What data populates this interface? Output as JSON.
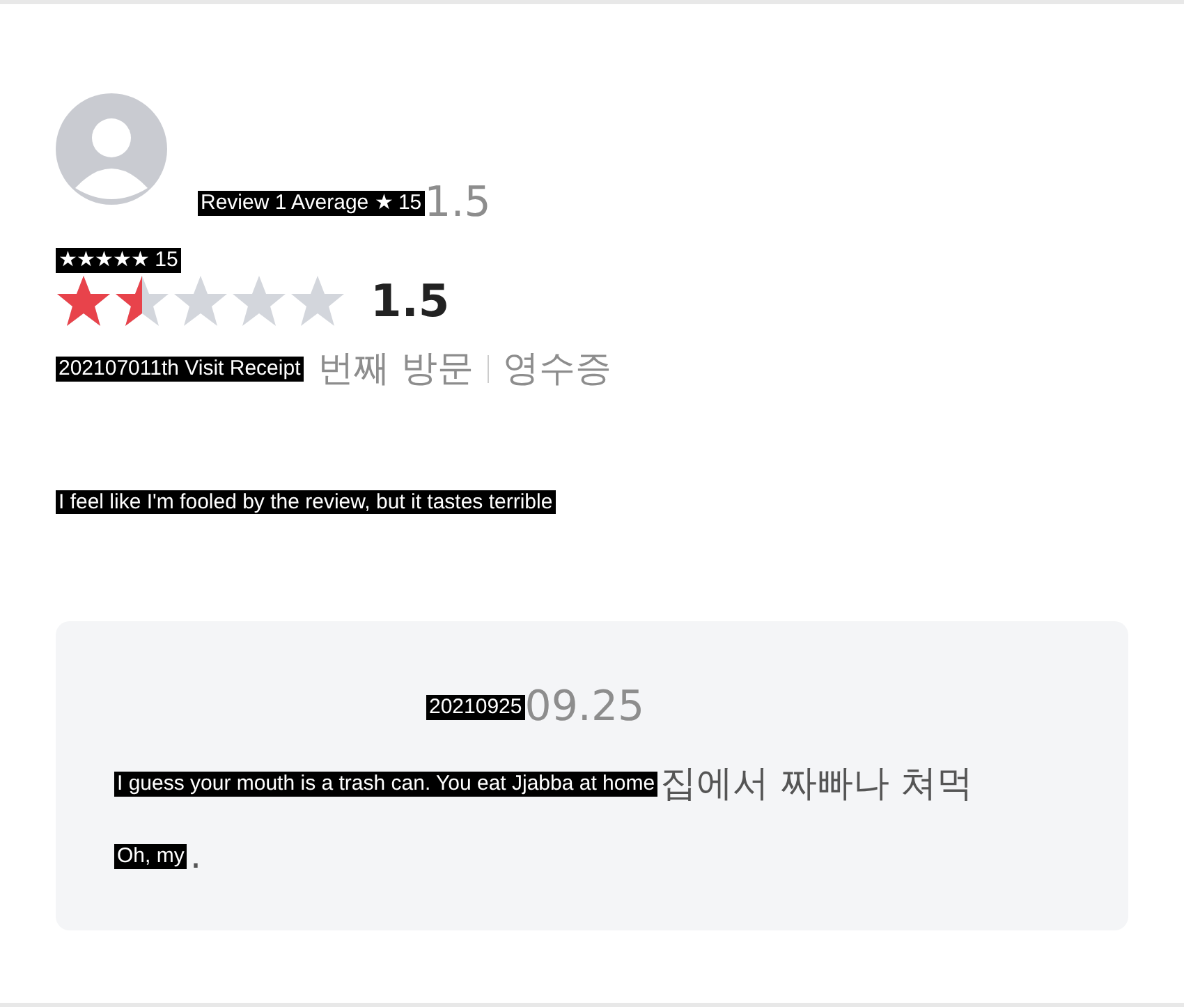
{
  "summary": {
    "caption": "Review 1 Average ★ 15",
    "tail": "1.5"
  },
  "rating": {
    "caption": "★★★★★ 15",
    "stars": 1.5,
    "score": "1.5"
  },
  "visit": {
    "caption": "202107011th Visit Receipt",
    "parts": [
      "번째 방문",
      "영수증"
    ]
  },
  "body": {
    "caption": "I feel like I'm fooled by the review, but it tastes terrible"
  },
  "reply": {
    "date": {
      "caption": "20210925",
      "tail": "09.25"
    },
    "lines": [
      {
        "caption": "I guess your mouth is a trash can. You eat Jjabba at home",
        "tail": "집에서 짜빠나 쳐먹"
      },
      {
        "caption": "Oh, my",
        "tail": "."
      }
    ]
  }
}
